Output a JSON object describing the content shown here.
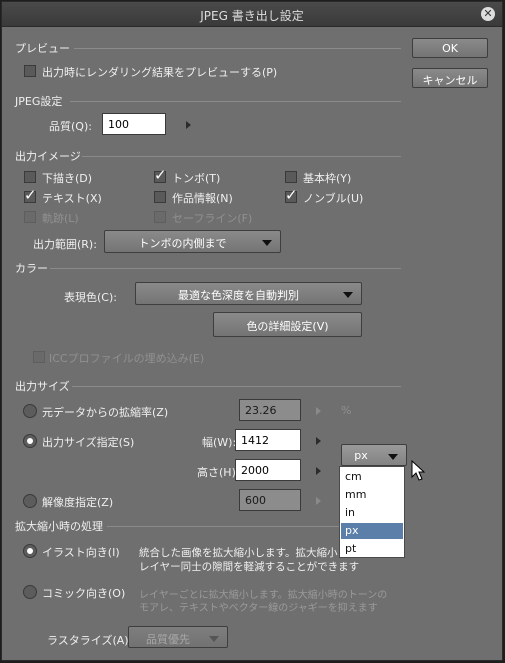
{
  "window": {
    "title": "JPEG 書き出し設定"
  },
  "buttons": {
    "ok": "OK",
    "cancel": "キャンセル",
    "color_detail": "色の詳細設定(V)"
  },
  "preview": {
    "section": "プレビュー",
    "checkbox": {
      "label": "出力時にレンダリング結果をプレビューする(P)",
      "checked": false
    }
  },
  "jpeg": {
    "section": "JPEG設定",
    "quality_label": "品質(Q):",
    "quality_value": "100"
  },
  "output_image": {
    "section": "出力イメージ",
    "checkboxes": [
      {
        "label": "下描き(D)",
        "checked": false,
        "enabled": true
      },
      {
        "label": "トンボ(T)",
        "checked": true,
        "enabled": true
      },
      {
        "label": "基本枠(Y)",
        "checked": false,
        "enabled": true
      },
      {
        "label": "テキスト(X)",
        "checked": true,
        "enabled": true
      },
      {
        "label": "作品情報(N)",
        "checked": false,
        "enabled": true
      },
      {
        "label": "ノンブル(U)",
        "checked": true,
        "enabled": true
      },
      {
        "label": "軌跡(L)",
        "checked": false,
        "enabled": false
      },
      {
        "label": "セーフライン(F)",
        "checked": false,
        "enabled": false
      }
    ],
    "range_label": "出力範囲(R):",
    "range_value": "トンボの内側まで"
  },
  "color": {
    "section": "カラー",
    "mode_label": "表現色(C):",
    "mode_value": "最適な色深度を自動判別",
    "icc_label": "ICCプロファイルの埋め込み(E)"
  },
  "output_size": {
    "section": "出力サイズ",
    "scale_label": "元データからの拡縮率(Z)",
    "scale_value": "23.26",
    "scale_unit": "%",
    "size_label": "出力サイズ指定(S)",
    "width_label": "幅(W):",
    "width_value": "1412",
    "height_label": "高さ(H):",
    "height_value": "2000",
    "unit_value": "px",
    "unit_options": [
      "cm",
      "mm",
      "in",
      "px",
      "pt"
    ],
    "resolution_label": "解像度指定(Z)",
    "resolution_value": "600"
  },
  "scaling": {
    "section": "拡大縮小時の処理",
    "illust_label": "イラスト向き(I)",
    "illust_desc_1": "統合した画像を拡大縮小します。拡大縮小",
    "illust_desc_2": "レイヤー同士の隙間を軽減することができます",
    "comic_label": "コミック向き(O)",
    "comic_desc_1": "レイヤーごとに拡大縮小します。拡大縮小時のトーンの",
    "comic_desc_2": "モアレ、テキストやベクター線のジャギーを抑えます",
    "rasterize_label": "ラスタライズ(A):",
    "rasterize_value": "品質優先"
  }
}
